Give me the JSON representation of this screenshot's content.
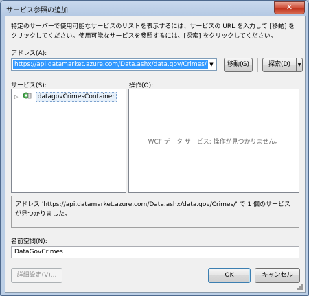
{
  "window": {
    "title": "サービス参照の追加",
    "close_label": "✕"
  },
  "description": "特定のサーバーで使用可能なサービスのリストを表示するには、サービスの URL を入力して [移動] をクリックしてください。使用可能なサービスを参照するには、[探索] をクリックしてください。",
  "address": {
    "label": "アドレス(A):",
    "value": "https://api.datamarket.azure.com/Data.ashx/data.gov/Crimes/",
    "go_button": "移動(G)",
    "discover_button": "探索(D)"
  },
  "services": {
    "label": "サービス(S):",
    "items": [
      {
        "label": "datagovCrimesContainer",
        "expanded": false,
        "selected": true
      }
    ]
  },
  "operations": {
    "label": "操作(O):",
    "empty_message": "WCF データ サービス: 操作が見つかりません。"
  },
  "status_message": "アドレス 'https://api.datamarket.azure.com/Data.ashx/data.gov/Crimes/' で 1 個のサービスが見つかりました。",
  "namespace": {
    "label": "名前空間(N):",
    "value": "DataGovCrimes"
  },
  "buttons": {
    "advanced": "詳細設定(V)...",
    "ok": "OK",
    "cancel": "キャンセル"
  },
  "icons": {
    "expand": "tree-expand-arrow-icon",
    "service": "service-globe-icon",
    "dropdown": "chevron-down-icon",
    "resize": "resize-grip-icon"
  },
  "colors": {
    "selection": "#3399ff",
    "title_close": "#c2361f"
  }
}
